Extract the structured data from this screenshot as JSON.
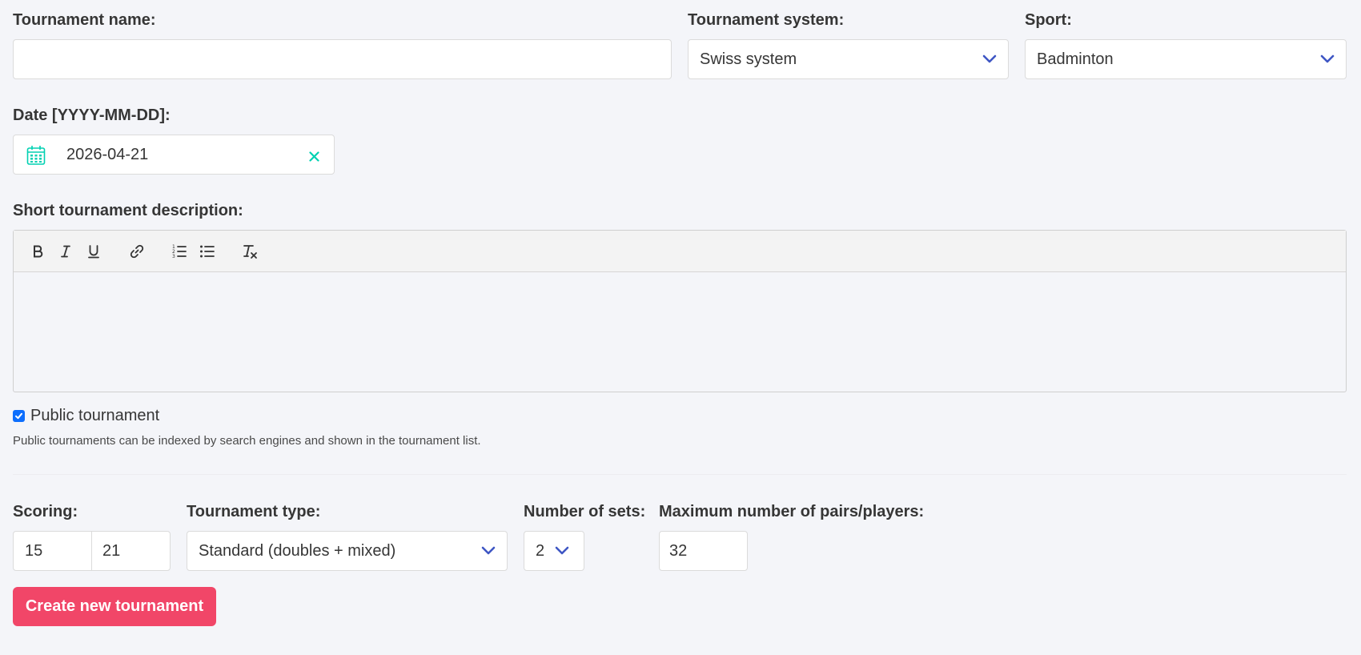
{
  "form": {
    "tournament_name": {
      "label": "Tournament name:",
      "value": ""
    },
    "tournament_system": {
      "label": "Tournament system:",
      "selected": "Swiss system"
    },
    "sport": {
      "label": "Sport:",
      "selected": "Badminton"
    },
    "date": {
      "label": "Date [YYYY-MM-DD]:",
      "value": "2026-04-21"
    },
    "description": {
      "label": "Short tournament description:",
      "toolbar": [
        "bold-icon",
        "italic-icon",
        "underline-icon",
        "link-icon",
        "ordered-list-icon",
        "bullet-list-icon",
        "clear-format-icon"
      ],
      "value": ""
    },
    "public": {
      "label": "Public tournament",
      "checked": true,
      "help": "Public tournaments can be indexed by search engines and shown in the tournament list."
    },
    "scoring": {
      "label": "Scoring:",
      "value_a": "15",
      "value_b": "21"
    },
    "tournament_type": {
      "label": "Tournament type:",
      "selected": "Standard (doubles + mixed)"
    },
    "number_of_sets": {
      "label": "Number of sets:",
      "selected": "2"
    },
    "max_pairs": {
      "label": "Maximum number of pairs/players:",
      "value": "32"
    },
    "submit_label": "Create new tournament"
  },
  "colors": {
    "accent": "#3e56c4",
    "date_icon": "#00d1b2",
    "primary_button": "#f14668",
    "checkbox": "#0d6efd"
  }
}
